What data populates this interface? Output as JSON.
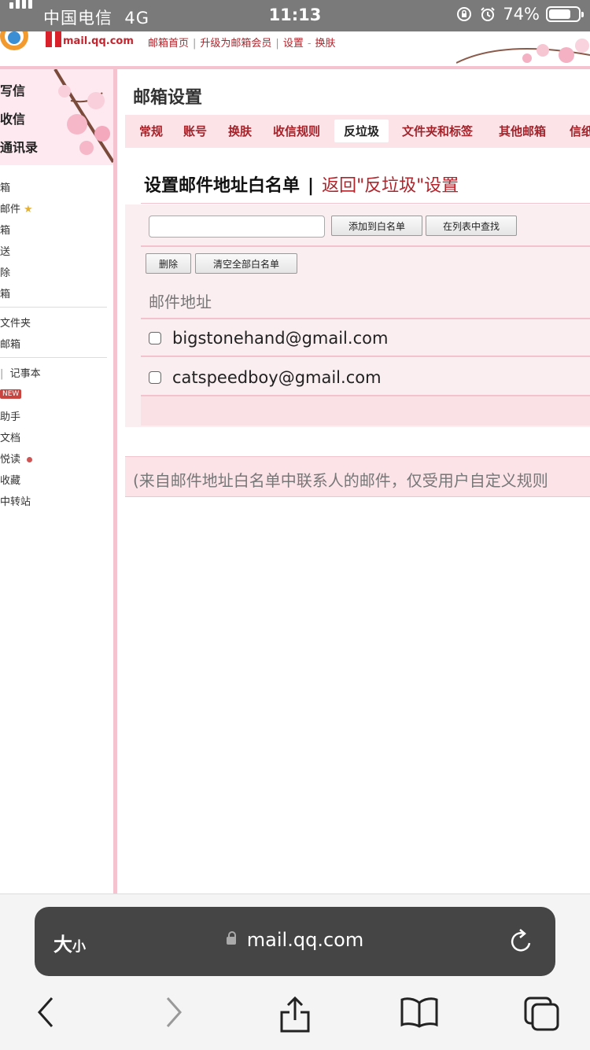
{
  "status_bar": {
    "carrier": "中国电信",
    "network": "4G",
    "time": "11:13",
    "battery": "74%",
    "battery_level": 0.74
  },
  "header": {
    "logo_text": "mail.qq.com",
    "links": [
      "邮箱首页",
      "升级为邮箱会员",
      "设置",
      "换肤"
    ]
  },
  "sidebar": {
    "actions": [
      "写信",
      "收信",
      "通讯录"
    ],
    "folders": [
      "箱",
      "邮件",
      "箱",
      "送",
      "除",
      "箱"
    ],
    "more": [
      "文件夹",
      "邮箱"
    ],
    "tools": [
      "记事本",
      "NEW",
      "助手",
      "文档",
      "悦读",
      "收藏",
      "中转站"
    ]
  },
  "main": {
    "title": "邮箱设置",
    "tabs": [
      "常规",
      "账号",
      "换肤",
      "收信规则",
      "反垃圾",
      "文件夹和标签",
      "其他邮箱",
      "信纸"
    ],
    "active_tab_index": 4,
    "section_title": "设置邮件地址白名单",
    "back_link": "返回\"反垃圾\"设置",
    "input_value": "",
    "add_button": "添加到白名单",
    "find_button": "在列表中查找",
    "delete_button": "删除",
    "clear_button": "清空全部白名单",
    "column_header": "邮件地址",
    "emails": [
      "bigstonehand@gmail.com",
      "catspeedboy@gmail.com"
    ],
    "footer_note": "(来自邮件地址白名单中联系人的邮件，仅受用户自定义规则"
  },
  "browser": {
    "text_size_label": "大",
    "text_size_small": "小",
    "url": "mail.qq.com"
  },
  "colors": {
    "accent": "#b0242b",
    "tab_bg": "#fbe3e8",
    "panel_bg": "#fbeef1",
    "border_pink": "#f4c3cf",
    "status_bar": "#7a7a7a"
  }
}
